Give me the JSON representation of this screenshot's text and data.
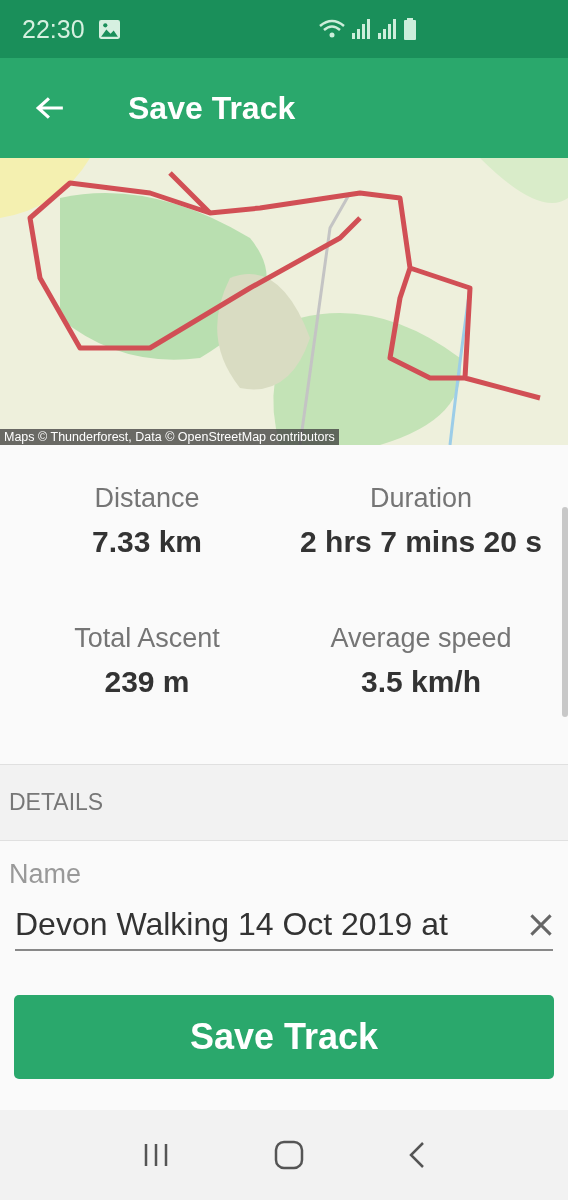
{
  "status_bar": {
    "time": "22:30"
  },
  "app_bar": {
    "title": "Save Track"
  },
  "map": {
    "kind": "picture",
    "attribution": "Maps © Thunderforest, Data © OpenStreetMap contributors"
  },
  "stats": [
    {
      "label": "Distance",
      "value": "7.33 km"
    },
    {
      "label": "Duration",
      "value": "2 hrs 7 mins 20 s"
    },
    {
      "label": "Total Ascent",
      "value": "239 m"
    },
    {
      "label": "Average speed",
      "value": "3.5 km/h"
    }
  ],
  "details": {
    "heading": "DETAILS",
    "name_label": "Name",
    "name_value": "Devon Walking 14 Oct 2019 at"
  },
  "save_button": "Save Track"
}
